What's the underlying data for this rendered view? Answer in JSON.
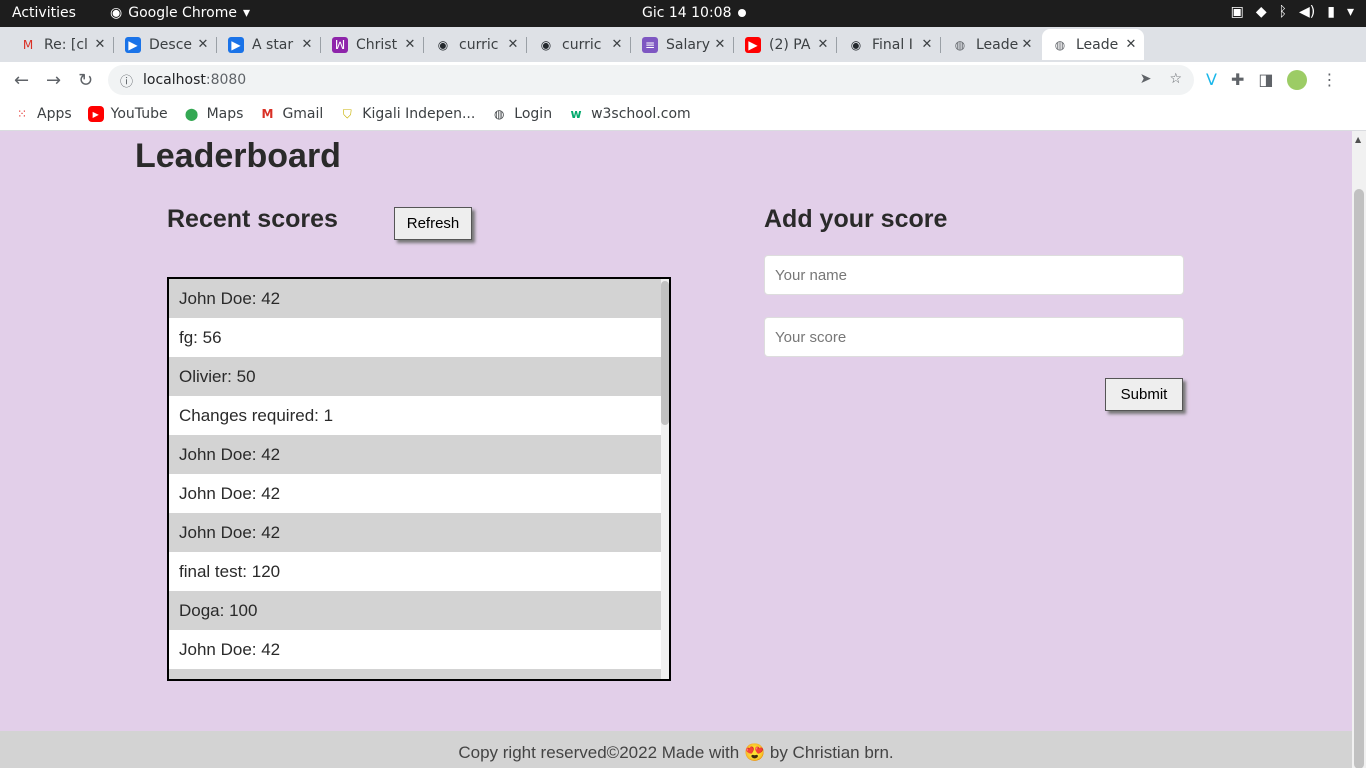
{
  "system": {
    "activities": "Activities",
    "app_name": "Google Chrome",
    "clock": "Gic 14  10:08"
  },
  "tabs": [
    {
      "title": "Re: [cl",
      "icon": "gmail-icon",
      "active": false
    },
    {
      "title": "Desce",
      "icon": "video-icon",
      "active": false
    },
    {
      "title": "A star",
      "icon": "video-icon",
      "active": false
    },
    {
      "title": "Christ",
      "icon": "app-icon",
      "active": false
    },
    {
      "title": "curric",
      "icon": "github-icon",
      "active": false
    },
    {
      "title": "curric",
      "icon": "github-icon",
      "active": false
    },
    {
      "title": "Salary",
      "icon": "doc-icon",
      "active": false
    },
    {
      "title": "(2) PA",
      "icon": "youtube-icon",
      "active": false
    },
    {
      "title": "Final I",
      "icon": "github-icon",
      "active": false
    },
    {
      "title": "Leade",
      "icon": "globe-icon",
      "active": false
    },
    {
      "title": "Leade",
      "icon": "globe-icon",
      "active": true
    }
  ],
  "address": {
    "host": "localhost",
    "port": ":8080"
  },
  "bookmarks": [
    "Apps",
    "YouTube",
    "Maps",
    "Gmail",
    "Kigali Indepen...",
    "Login",
    "w3school.com"
  ],
  "page": {
    "title": "Leaderboard",
    "recent_heading": "Recent scores",
    "refresh_label": "Refresh",
    "add_heading": "Add your score",
    "name_placeholder": "Your name",
    "score_placeholder": "Your score",
    "submit_label": "Submit",
    "scores": [
      "John Doe: 42",
      "fg: 56",
      "Olivier: 50",
      "Changes required: 1",
      "John Doe: 42",
      "John Doe: 42",
      "John Doe: 42",
      "final test: 120",
      "Doga: 100",
      "John Doe: 42",
      ""
    ],
    "footer": {
      "before": "Copy right reserved©2022  Made with ",
      "emoji": "😍",
      "after": " by Christian brn."
    }
  }
}
